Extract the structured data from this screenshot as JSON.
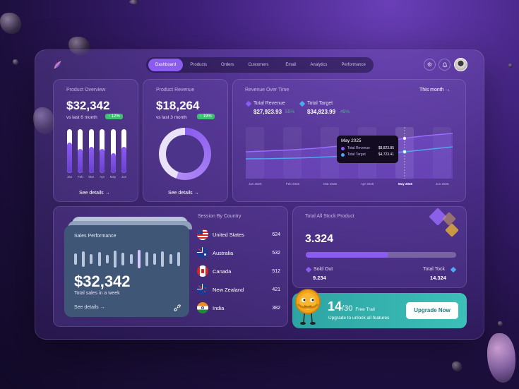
{
  "nav": {
    "tabs": [
      "Dashboard",
      "Products",
      "Orders",
      "Customers",
      "Email",
      "Analytics",
      "Performance"
    ],
    "active": "Dashboard"
  },
  "product_overview": {
    "title": "Product Overview",
    "value": "$32,342",
    "subtitle": "vs last 6 month",
    "badge": "↑ 12%",
    "link": "See details →",
    "months": [
      "Jan",
      "Feb",
      "Mar",
      "Apr",
      "May",
      "Jun"
    ],
    "levels": [
      0.7,
      0.55,
      0.6,
      0.55,
      0.45,
      0.6
    ]
  },
  "product_revenue": {
    "title": "Product Revenue",
    "value": "$18,264",
    "subtitle": "vs last 3 month",
    "badge": "↑ 19%",
    "link": "See details →",
    "fill": 0.56
  },
  "revenue_over_time": {
    "title": "Revenue Over Time",
    "period": "This month →",
    "legend": [
      {
        "label": "Total Revenue",
        "value": "$27,923.93",
        "change": "55%",
        "color": "#8a5cf0"
      },
      {
        "label": "Total Target",
        "value": "$34,823.99",
        "change": "45%",
        "color": "#4ea8f0"
      }
    ],
    "months": [
      "Jan 2025",
      "Feb 2025",
      "Mar 2025",
      "Apr 2025",
      "May 2025",
      "Jun 2025"
    ],
    "tooltip": {
      "title": "May 2025",
      "rows": [
        {
          "label": "Total Revenue",
          "value": "$8,823.85"
        },
        {
          "label": "Total Target",
          "value": "$4,723.41"
        }
      ]
    }
  },
  "sales_performance": {
    "title": "Sales Performance",
    "value": "$32,342",
    "subtitle": "Total sales in a week",
    "link": "See details →"
  },
  "session_by_country": {
    "title": "Session By Country",
    "rows": [
      {
        "country": "United States",
        "value": "624"
      },
      {
        "country": "Australia",
        "value": "532"
      },
      {
        "country": "Canada",
        "value": "512"
      },
      {
        "country": "New Zealand",
        "value": "421"
      },
      {
        "country": "India",
        "value": "382"
      }
    ]
  },
  "stock": {
    "title": "Total All Stock Product",
    "value": "3.324",
    "progress": 0.55,
    "sold_label": "Sold Out",
    "sold_value": "9.234",
    "total_label": "Total Tock",
    "total_value": "14.324"
  },
  "upgrade": {
    "count": "14",
    "total": "/30",
    "trial": "Free Trail",
    "subtitle": "Upgrade to unlock all features",
    "button": "Upgrade Now"
  },
  "colors": {
    "accent": "#8a5cf0",
    "success": "#3fbf73",
    "target": "#4ea8f0",
    "teal": "#2ea3a3"
  }
}
